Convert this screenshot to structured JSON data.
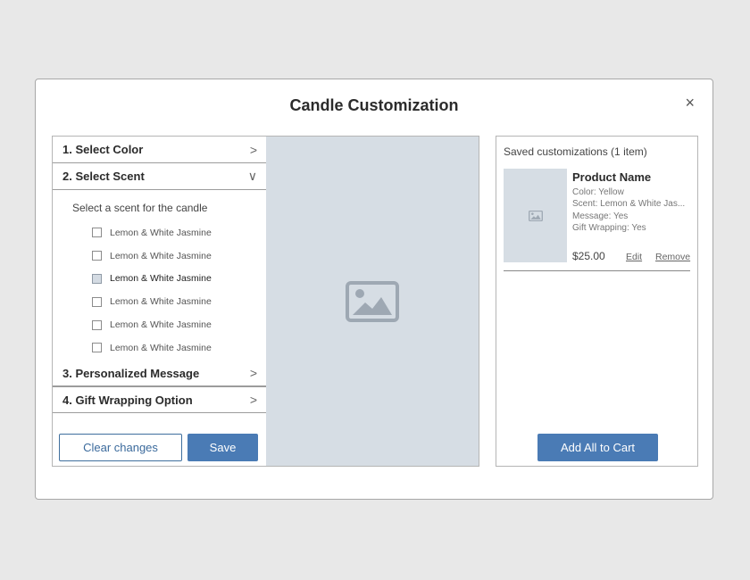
{
  "modal": {
    "title": "Candle Customization",
    "close_glyph": "×"
  },
  "steps": {
    "color": {
      "label": "1. Select Color",
      "chevron": ">"
    },
    "scent": {
      "label": "2. Select Scent",
      "chevron": "∨",
      "prompt": "Select a scent for the candle",
      "options": [
        {
          "label": "Lemon & White Jasmine",
          "checked": false
        },
        {
          "label": "Lemon & White Jasmine",
          "checked": false
        },
        {
          "label": "Lemon & White Jasmine",
          "checked": true
        },
        {
          "label": "Lemon & White Jasmine",
          "checked": false
        },
        {
          "label": "Lemon & White Jasmine",
          "checked": false
        },
        {
          "label": "Lemon & White Jasmine",
          "checked": false
        }
      ]
    },
    "message": {
      "label": "3. Personalized Message",
      "chevron": ">"
    },
    "gift": {
      "label": "4. Gift Wrapping Option",
      "chevron": ">"
    }
  },
  "actions": {
    "clear_label": "Clear changes",
    "save_label": "Save"
  },
  "preview": {
    "icon": "image-placeholder-icon"
  },
  "saved": {
    "title": "Saved customizations (1 item)",
    "item": {
      "name": "Product Name",
      "color": "Color: Yellow",
      "scent": "Scent: Lemon & White Jas...",
      "message": "Message: Yes",
      "gift": "Gift Wrapping: Yes",
      "price": "$25.00",
      "edit_label": "Edit",
      "remove_label": "Remove"
    },
    "cart_label": "Add All to Cart"
  },
  "colors": {
    "accent": "#4a7bb5",
    "placeholder_bg": "#d6dde4"
  }
}
